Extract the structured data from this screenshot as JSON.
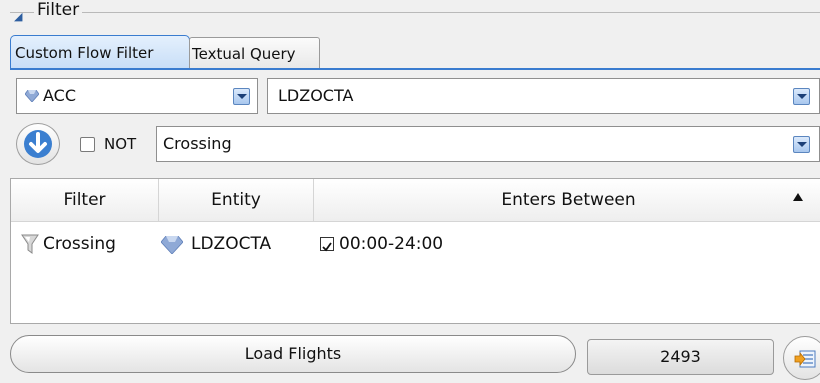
{
  "group": {
    "title": "Filter"
  },
  "tabs": [
    {
      "label": "Custom Flow Filter",
      "active": true
    },
    {
      "label": "Textual Query",
      "active": false
    }
  ],
  "level_combo": {
    "value": "ACC",
    "icon": "diamond-icon"
  },
  "entity_combo": {
    "value": "LDZOCTA"
  },
  "not_option": {
    "label": "NOT",
    "checked": false
  },
  "filter_combo": {
    "value": "Crossing"
  },
  "table": {
    "columns": [
      "Filter",
      "Entity",
      "Enters Between"
    ],
    "rows": [
      {
        "filter": "Crossing",
        "entity": "LDZOCTA",
        "checked": true,
        "enters_between": "00:00-24:00"
      }
    ]
  },
  "load_button": {
    "label": "Load Flights"
  },
  "flight_count": "2493",
  "colors": {
    "accent": "#3a7ccf",
    "diamond": "#8fa9d6"
  }
}
